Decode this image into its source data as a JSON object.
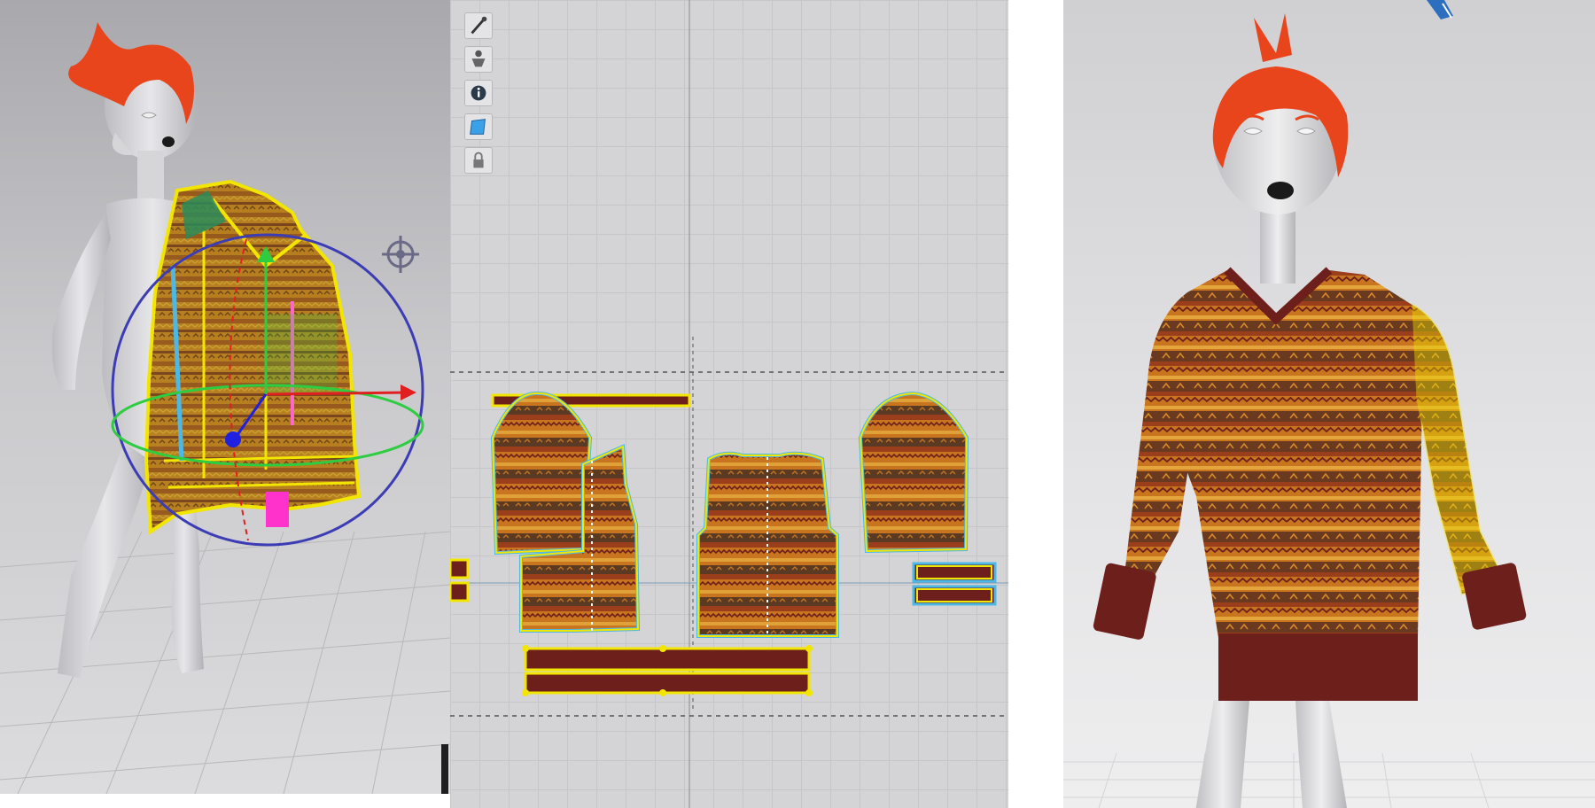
{
  "app": {
    "panels": [
      "3d-view",
      "2d-pattern-window",
      "3d-preview"
    ]
  },
  "toolbar_2d": {
    "tools": [
      {
        "icon": "brush-icon"
      },
      {
        "icon": "avatar-pose-icon"
      },
      {
        "icon": "info-icon"
      },
      {
        "icon": "fabric-texture-icon"
      },
      {
        "icon": "lock-icon"
      }
    ]
  },
  "colors": {
    "hair": "#e8451c",
    "fabric_orange": "#c9751f",
    "fabric_rust": "#9a3e1c",
    "fabric_maroon": "#6d1f1b",
    "outline_selected": "#f2e600",
    "outline_pattern": "#4bb8e6",
    "gizmo_ring": "#3c3cb4",
    "gizmo_x": "#e02020",
    "gizmo_y": "#2ecc40",
    "gizmo_z": "#2020e0",
    "marker_magenta": "#ff33cc"
  }
}
